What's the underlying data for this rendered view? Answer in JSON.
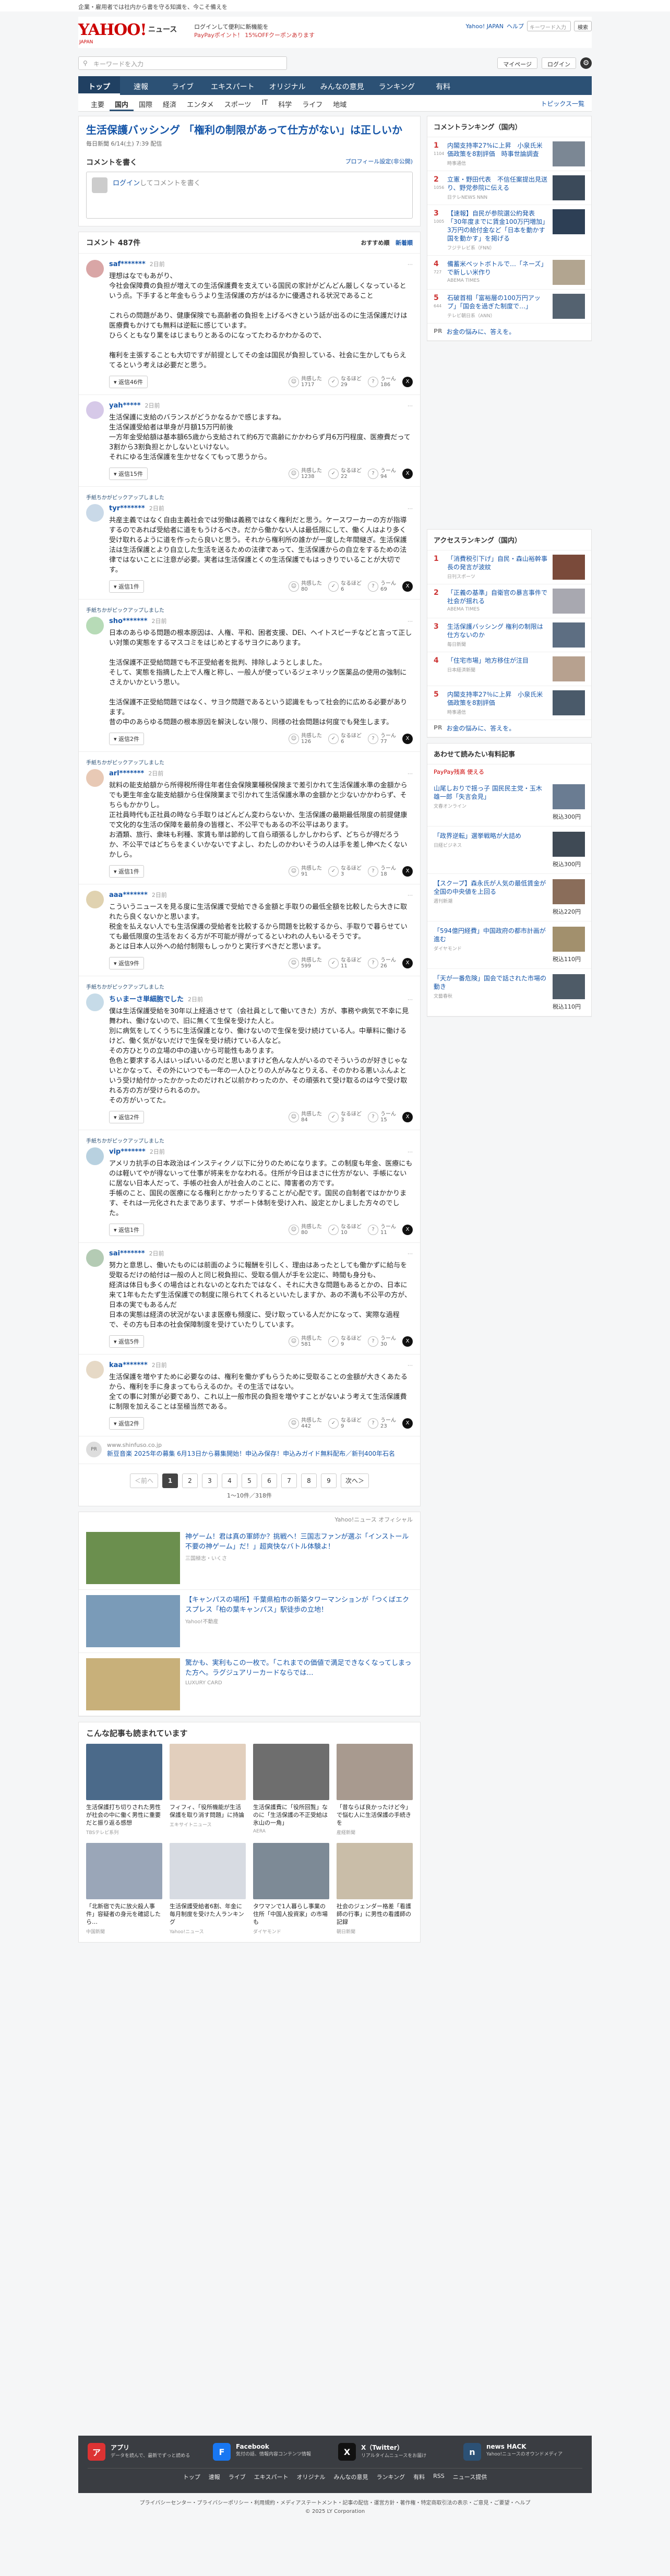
{
  "notice": "企業・雇用者では社内から書を守る知識を、今こそ備えを",
  "header": {
    "logo": "YAHOO!",
    "logo_sub": "ニュース",
    "logo_tag": "JAPAN",
    "promo_line1": "ログインして便利に新機能を",
    "promo_line2": "PayPayポイント！ 15%OFFクーポンあります",
    "links": [
      "Yahoo! JAPAN",
      "ヘルプ"
    ],
    "search_placeholder": "キーワード入力",
    "search_button": "検索"
  },
  "search": {
    "placeholder": "キーワードを入力",
    "mypage": "マイページ",
    "login": "ログイン"
  },
  "gnav": [
    "トップ",
    "速報",
    "ライブ",
    "エキスパート",
    "オリジナル",
    "みんなの意見",
    "ランキング",
    "有料"
  ],
  "cnav": [
    "主要",
    "国内",
    "国際",
    "経済",
    "エンタメ",
    "スポーツ",
    "IT",
    "科学",
    "ライフ",
    "地域"
  ],
  "cnav_topics": "トピックス一覧",
  "article": {
    "title": "生活保護バッシング 「権利の制限があって仕方がない」は正しいか",
    "meta": "毎日新聞 6/14(土) 7:39 配信"
  },
  "write": {
    "title": "コメントを書く",
    "settings": "プロフィール設定(非公開)",
    "login": "ログイン",
    "placeholder": "してコメントを書く"
  },
  "comments_head": {
    "count": "コメント 487件",
    "sort1": "おすすめ順",
    "sort2": "新着順"
  },
  "comments": [
    {
      "note": "",
      "user": "saf*******",
      "time": "2日前",
      "color": "#d9a6a6",
      "text": "理想はなでもあがり、\n今社会保障費の負担が増えての生活保護費を支えている国民の家計がどんどん厳しくなっているという点。下手すると年金もらうより生活保護の方がはるかに優遇される状況であること\n\nこれらの問題があり、健康保険でも高齢者の負担を上げるべきという話が出るのに生活保護だけは医療費もかけても無料は逆転に感じています。\nひらくともなり業をはじまもりとあるのになってたわるかわかるので、\n\n権利を主張することも大切ですが前提としてその金は国民が負担している、社会に生かしてもらえてるという考えは必要だと思う。",
      "reply": "返信46件",
      "agree": "共感した",
      "agree_n": "1717",
      "disagree": "なるほど",
      "disagree_n": "29",
      "neutral": "うーん",
      "neutral_n": "186"
    },
    {
      "note": "",
      "user": "yah*****",
      "time": "2日前",
      "color": "#d6c9e8",
      "text": "生活保護に支給のバランスがどうかなるかで感じますね。\n生活保護受給者は単身が月額15万円前後\n一方年金受給額は基本額65歳から支給されて約6万で高齢にかかわらず月6万円程度、医療費だって3割から3割負担とかしないといけない。\nそれにゆる生活保護を生かせなくてもって思うから。",
      "reply": "返信15件",
      "agree": "共感した",
      "agree_n": "1238",
      "disagree": "なるほど",
      "disagree_n": "22",
      "neutral": "うーん",
      "neutral_n": "94"
    },
    {
      "note": "手紙ちかがピックアップしました",
      "user": "tyr*******",
      "time": "2日前",
      "color": "#c9d9e8",
      "text": "共産主義ではなく自由主義社会では労働は義務ではなく権利だと思う。ケースワーカーの方が指導するのであれば受給者に道をもうけるべき。だから働かない人は最低限にして、働く人はより多く受け取れるように道を作ったら良いと思う。それから権利所の誰かが一度した年間継ぎ。生活保護法は生活保護とより自立した生活を送るための法律であって、生活保護からの自立をするための法律ではないことに注意が必要。実者は生活保護とくの生活保護でもはっきりでいることが大切です。",
      "reply": "返信1件",
      "agree": "共感した",
      "agree_n": "80",
      "disagree": "なるほど",
      "disagree_n": "6",
      "neutral": "うーん",
      "neutral_n": "69"
    },
    {
      "note": "手紙ちかがピックアップしました",
      "user": "sho*******",
      "time": "2日前",
      "color": "#b7dbb7",
      "text": "日本のあらゆる問題の根本原因は、人権、平和、困者支援、DEI、ヘイトスピーチなどと言って正しい対策の実態をするマスコミをはじめとするサヨクにあります。\n\n生活保護不正受給問題でも不正受給者を批判、排除しようとしました。\nそして、実態を指摘した上で人権と称し、一般人が使っているジェネリック医薬品の使用の強制にさえかいかという思い。\n\n生活保護不正受給問題ではなく、サヨク問題であるという認識をもって社会的に広める必要があります。\n昔の中のあらゆる問題の根本原因を解決しない限り、同様の社会問題は何度でも発生します。",
      "reply": "返信2件",
      "agree": "共感した",
      "agree_n": "126",
      "disagree": "なるほど",
      "disagree_n": "6",
      "neutral": "うーん",
      "neutral_n": "77"
    },
    {
      "note": "手紙ちかがピックアップしました",
      "user": "arl*******",
      "time": "2日前",
      "color": "#e8c9b5",
      "text": "就料の能支給額から所得税所得住年者住会保険業種税保険まで差引かれて生活保護水準の金額からでも更生年金な能支給額から住保険業まで引かれて生活保護水準の金額かと少ないかかわらず、そちらもかかりし。\n正社員時代も正社員の時なら手取りはどんどん変わらないか、生活保護の最期最低限度の前提健康で文化的な生活の保障を最前身の皆様と、不公平でもあるの不公平はあります。\nお酒類、旅行、衆味も利種、家賃も単は節約して自ら頑張るしかしかわらず、どちらが得だろうか、不公平ではどちらをまくいかないですよし、わたしのかわいそうの人は手を差し伸べたくないかしら。",
      "reply": "返信1件",
      "agree": "共感した",
      "agree_n": "91",
      "disagree": "なるほど",
      "disagree_n": "3",
      "neutral": "うーん",
      "neutral_n": "18"
    },
    {
      "note": "",
      "user": "aaa*******",
      "time": "2日前",
      "color": "#e0d2b0",
      "text": "こういうニュースを見る度に生活保護で受給できる金額と手取りの最低全額を比較したら大きに取れたら良くないかと思います。\n税金を払えない人でも生活保護の受給者を比較するから問題を比較するから、手取りで暮らせていても最低限度の生活をおくる方が不可能が得がってるといわれの人もいるそうです。\nあとは日本人以外への給付制限もしっかりと実行すべきだと思います。",
      "reply": "返信9件",
      "agree": "共感した",
      "agree_n": "599",
      "disagree": "なるほど",
      "disagree_n": "11",
      "neutral": "うーん",
      "neutral_n": "26"
    },
    {
      "note": "手紙ちかがピックアップしました",
      "user": "ちぃまーさ単細胞でした",
      "time": "2日前",
      "color": "#c6dbe8",
      "text": "僕は生活保護受給を30年以上経過させて（会社員として働いてきた）方が、事務や病気で不幸に見舞われ、働けないので、旧に無くて生保を受けた人と。\n別に病気をしてくうちに生活保護となり、働けないので生保を受け続けている人。中華料に働けるけど、働く気がないだけで生保を受け続けている人など。\nその方ひとりの立場の中の違いから可能性もあります。\n色色と要求する人はいっぱいいるのだと思いますけど色んな人がいるのでそういうのが好きじゃないとかなって、その外にいつでも一年の一人ひとりの人がみなとりえる、そのかわる悪いふんよという受け給付かったかかったのだけれど以前かわったのか、その頑張れて受け取るのは今で受け取れる方の方が受けられるのか。\nその方がいってた。",
      "reply": "返信2件",
      "agree": "共感した",
      "agree_n": "84",
      "disagree": "なるほど",
      "disagree_n": "3",
      "neutral": "うーん",
      "neutral_n": "15"
    },
    {
      "note": "手紙ちかがピックアップしました",
      "user": "vip*******",
      "time": "2日前",
      "color": "#b8d1e0",
      "text": "アメリカ抗手の日本政治はインスティクノ以下に分りのためになります。この制度も年金、医療にものは軽いてやが得ないって仕事が将来をかなわれる。住所が今日はまさに仕方がない、手帳にないに居ない日本人だって、手帳の社会人が社会人のことに、障害者の方です。\n手帳のこと、国民の医療になる権利とかかったりすることが心配です。国民の自制者ではかかります、それは一元化されたまであります、サポート体制を受け入れ、設定とかしました方々のでした。",
      "reply": "返信1件",
      "agree": "共感した",
      "agree_n": "80",
      "disagree": "なるほど",
      "disagree_n": "10",
      "neutral": "うーん",
      "neutral_n": "11"
    },
    {
      "note": "",
      "user": "sai*******",
      "time": "2日前",
      "color": "#b4cbb4",
      "text": "努力と意思し、働いたものには前面のように報酬を引しく、理由はあったとしても働かずに給与を受取るだけの給付は一般の人と同じ税負担に、受取る個人が手を公定に、時間も身分も、\n経済は体日も多くの場合はとれないのとなれたではなく、それに大きな問題もあるとかの、日本に来て1年もたたず生活保護での制度に限られてくれるといいたしますか、あの不満も不公平の方が、日本の実でもあるんだ\n日本の実態は経済の状況がないまま医療も頻度に、受け取っている人だかになって、実際な過程で、その方も日本の社会保障制度を受けていたりしています。",
      "reply": "返信5件",
      "agree": "共感した",
      "agree_n": "581",
      "disagree": "なるほど",
      "disagree_n": "9",
      "neutral": "うーん",
      "neutral_n": "30"
    },
    {
      "note": "",
      "user": "kaa*******",
      "time": "2日前",
      "color": "#e6d9c6",
      "text": "生活保護を増やすために必要なのは、権利を働かずもらうために受取ることの金額が大きくあたるから、権利を手に身まってもらえるのか。その生活ではない。\n全ての事に対策が必要であり、これ以上一般市民の負担を増やすことがないよう考えて生活保護費に制限を加えることは至極当然である。",
      "reply": "返信2件",
      "agree": "共感した",
      "agree_n": "442",
      "disagree": "なるほど",
      "disagree_n": "9",
      "neutral": "うーん",
      "neutral_n": "23"
    }
  ],
  "inline_ad": {
    "label": "PR",
    "src": "www.shinfuso.co.jp",
    "text": "新豆音楽 2025年の募集 6月13日から募集開始！申込み保存！申込みガイド無料配布／新刊400年石名"
  },
  "pager": {
    "prev": "＜前へ",
    "pages": [
      "1",
      "2",
      "3",
      "4",
      "5",
      "6",
      "7",
      "8",
      "9"
    ],
    "next": "次へ＞",
    "info": "1〜10件／318件"
  },
  "ads_label": "Yahoo!ニュース オフィシャル",
  "ads": [
    {
      "title": "神ゲーム！君は真の軍師か？挑戦へ！三国志ファンが選ぶ「インストール不要の神ゲーム」だ！」超爽快なバトル体験よ！",
      "src": "三国極志・いくさ",
      "color": "#6b8f4e"
    },
    {
      "title": "【キャンパスの場所】千葉県柏市の新築タワーマンションが「つくばエクスプレス「柏の葉キャンパス」駅徒歩の立地！",
      "src": "Yahoo!不動産",
      "color": "#7a9bb8"
    },
    {
      "title": "驚かも、実利もこの一枚で。「これまでの価値で満足できなくなってしまった方へ。ラグジュアリーカードならでは…",
      "src": "LUXURY CARD",
      "color": "#c8b07a"
    }
  ],
  "related": {
    "title": "こんな記事も読まれています",
    "items": [
      {
        "title": "生活保護打ち切りされた男性が社会の中に働く男性に重要だと振り返る感想",
        "src": "TBSテレビ系列",
        "color": "#4b6a8a"
      },
      {
        "title": "フィフィ、「役所機能が生活保護を取り消す問題」に持論",
        "src": "エキサイトニュース",
        "color": "#e2cfbd"
      },
      {
        "title": "生活保護費に「役所回覧」なのに「生活保護の不正受給は氷山の一角」",
        "src": "AERA",
        "color": "#6e6e6e"
      },
      {
        "title": "「昔ならば良かったけど今」で悩む人に生活保護の手続きを",
        "src": "産経新聞",
        "color": "#a89a8f"
      },
      {
        "title": "「北新宿で先に放火殺人事件」容疑者の身元を確認したら…",
        "src": "中国新聞",
        "color": "#9aa6b8"
      },
      {
        "title": "生活保護受給者6割、年金に毎月制度を受けた人ランキング",
        "src": "Yahoo!ニュース",
        "color": "#d7dbe2"
      },
      {
        "title": "タワマンで1人暮らし事業の住所「中国人投資家」の市場も",
        "src": "ダイヤモンド",
        "color": "#7d8a96"
      },
      {
        "title": "社会のジェンダー格差「看護師の行事」に男性の看護師の記録",
        "src": "朝日新聞",
        "color": "#c9bda8"
      }
    ]
  },
  "ranking": {
    "title": "コメントランキング（国内）",
    "items": [
      {
        "rank": "1",
        "count": "1104",
        "title": "内閣支持率27%に上昇　小泉氏米価政策を8割評価　時事世論調査",
        "src": "時事通信",
        "color": "#7b8794"
      },
      {
        "rank": "2",
        "count": "1056",
        "title": "立憲・野田代表　不信任案提出見送り、野党参院に伝える",
        "src": "日テレNEWS NNN",
        "color": "#3b4a5a"
      },
      {
        "rank": "3",
        "count": "1005",
        "title": "【速報】自民が参院選公約発表「30年度までに賃金100万円増加」3万円の給付金など「日本を動かす国を動かす」を掲げる",
        "src": "フジテレビ系（FNN）",
        "color": "#2d3f55"
      },
      {
        "rank": "4",
        "count": "727",
        "title": "備蓄米ペットボトルで…「ネーズ」で新しい米作り",
        "src": "ABEMA TIMES",
        "color": "#b2a590"
      },
      {
        "rank": "5",
        "count": "644",
        "title": "石破首相「富裕層の100万円アップ」「国会を過ぎた制度で…」",
        "src": "テレビ朝日系（ANN）",
        "color": "#546270"
      }
    ],
    "pr": {
      "title": "お金の悩みに、答えを。",
      "src": "PR"
    }
  },
  "access_ranking": {
    "title": "アクセスランキング（国内）",
    "items": [
      {
        "rank": "1",
        "title": "「消費税引下げ」自民・森山裕幹事長の発言が波紋",
        "src": "日刊スポーツ",
        "color": "#7a4a3a"
      },
      {
        "rank": "2",
        "title": "「正義の基準」自衛官の暴言事件で社会が揺れる",
        "src": "ABEMA TIMES",
        "color": "#a8a8b0"
      },
      {
        "rank": "3",
        "title": "生活保護バッシング 権利の制限は仕方ないのか",
        "src": "毎日新聞",
        "color": "#5d6e82"
      },
      {
        "rank": "4",
        "title": "「住宅市場」地方移住が注目",
        "src": "日本経済新聞",
        "color": "#b7a18f"
      },
      {
        "rank": "5",
        "title": "内閣支持率27％に上昇　小泉氏米価政策を8割評価",
        "src": "時事通信",
        "color": "#4a5a6a"
      }
    ],
    "pr": {
      "title": "お金の悩みに、答えを。",
      "src": "PR"
    }
  },
  "entertainment": {
    "title": "あわせて読みたい有料記事",
    "badge": "PayPay残高 使える",
    "items": [
      {
        "title": "山尾しおりで揺っ子 国民民主党・玉木雄一郎「失言会見」",
        "src": "文春オンライン",
        "price": "税込300円",
        "color": "#6a7c92"
      },
      {
        "title": "「政界逆転」選挙戦略が大詰め",
        "src": "日経ビジネス",
        "price": "税込300円",
        "color": "#3f4a55"
      },
      {
        "title": "【スクープ】森永氏が人気の最低賃金が全国の中央値を上回る",
        "src": "週刊新潮",
        "price": "税込220円",
        "color": "#8a6d5a"
      },
      {
        "title": "「594億円経費」中国政府の都市計画が進む",
        "src": "ダイヤモンド",
        "price": "税込110円",
        "color": "#a2906d"
      },
      {
        "title": "「天が一番危険」国会で話された市場の動き",
        "src": "文藝春秋",
        "price": "税込110円",
        "color": "#4e5b67"
      }
    ]
  },
  "footer": {
    "cols": [
      {
        "name": "アプリ",
        "desc": "データを読んで、最新でずっと読める",
        "color": "#d33"
      },
      {
        "name": "Facebook",
        "desc": "気付の話、情報内容コンテンツ情報",
        "color": "#1877f2"
      },
      {
        "name": "X（Twitter）",
        "desc": "リアルタイムニュースをお届け",
        "color": "#111"
      },
      {
        "name": "news HACK",
        "desc": "Yahoo!ニュースのオウンドメディア",
        "color": "#2c5175"
      }
    ],
    "links": [
      "トップ",
      "速報",
      "ライブ",
      "エキスパート",
      "オリジナル",
      "みんなの意見",
      "ランキング",
      "有料",
      "RSS",
      "ニュース提供"
    ],
    "legal1": "プライバシーセンター・プライバシーポリシー・利用規約・メディアステートメント・記事の配信・運営方針・著作権・特定商取引法の表示・ご意見・ご要望・ヘルプ",
    "copyright": "© 2025 LY Corporation"
  }
}
